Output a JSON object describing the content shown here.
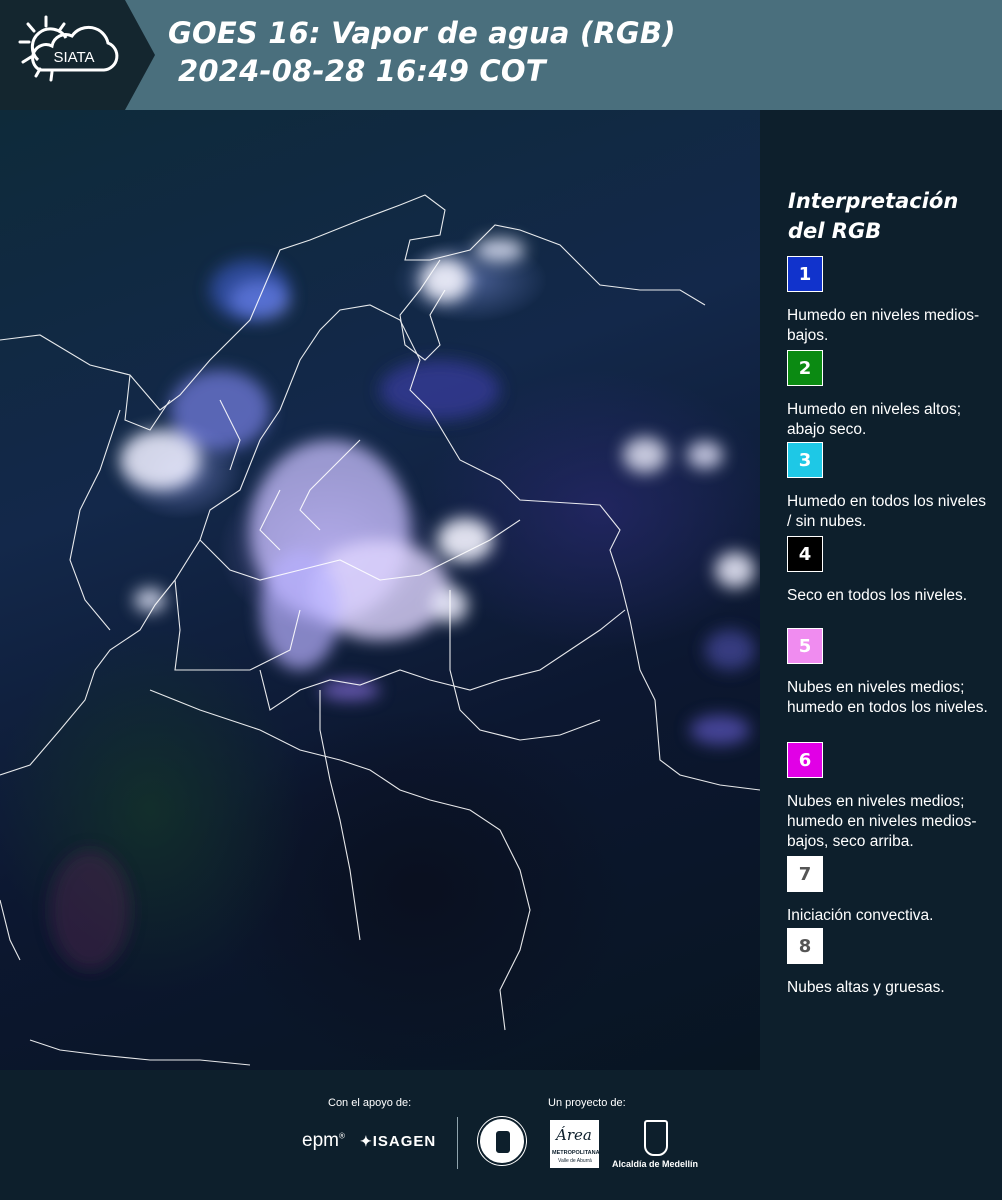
{
  "header": {
    "logo_text": "SIATA",
    "title_line1": "GOES 16: Vapor de agua (RGB)",
    "title_line2": "2024-08-28 16:49 COT",
    "background_color": "#4a6f7d",
    "logo_background_color": "#14262f"
  },
  "map": {
    "image_type": "satellite-water-vapor-rgb",
    "region": "Colombia"
  },
  "legend": {
    "title": "Interpretación del RGB",
    "items": [
      {
        "number": "1",
        "color": "#1133cc",
        "text_color": "#ffffff",
        "label": "Humedo en niveles medios-bajos."
      },
      {
        "number": "2",
        "color": "#0b8a12",
        "text_color": "#ffffff",
        "label": "Humedo en niveles altos; abajo seco."
      },
      {
        "number": "3",
        "color": "#1ec8e6",
        "text_color": "#ffffff",
        "label": "Humedo en todos los niveles / sin nubes."
      },
      {
        "number": "4",
        "color": "#000000",
        "text_color": "#ffffff",
        "label": "Seco en todos los niveles."
      },
      {
        "number": "5",
        "color": "#f08cf0",
        "text_color": "#ffffff",
        "label": "Nubes en niveles medios; humedo en todos los niveles."
      },
      {
        "number": "6",
        "color": "#e100e6",
        "text_color": "#ffffff",
        "label": "Nubes en niveles medios; humedo en niveles medios-bajos, seco arriba."
      },
      {
        "number": "7",
        "color": "#ffffff",
        "text_color": "#555555",
        "label": "Iniciación convectiva."
      },
      {
        "number": "8",
        "color": "#ffffff",
        "text_color": "#555555",
        "label": "Nubes altas y gruesas."
      }
    ]
  },
  "footer": {
    "support_label": "Con el apoyo de:",
    "project_label": "Un proyecto de:",
    "sponsors": [
      "epm",
      "ISAGEN"
    ],
    "partners": [
      "METROPOLITANA",
      "Alcaldía de Medellín"
    ],
    "area_logo_text": "Área",
    "area_logo_subtext": "Valle de Aburrá"
  }
}
